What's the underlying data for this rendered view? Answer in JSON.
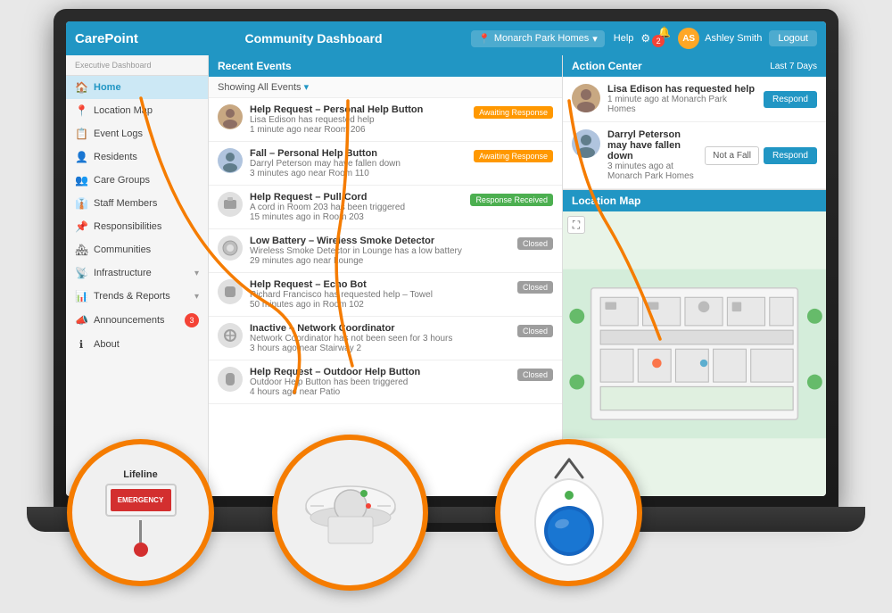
{
  "brand": "CarePoint",
  "topbar": {
    "title": "Community Dashboard",
    "location": "Monarch Park Homes",
    "help": "Help",
    "user": "Ashley Smith",
    "logout": "Logout",
    "notification_count": "2"
  },
  "sidebar": {
    "exec_label": "Executive Dashboard",
    "items": [
      {
        "id": "home",
        "label": "Home",
        "icon": "🏠",
        "active": true
      },
      {
        "id": "location-map",
        "label": "Location Map",
        "icon": "📍",
        "active": false
      },
      {
        "id": "event-logs",
        "label": "Event Logs",
        "icon": "📋",
        "active": false
      },
      {
        "id": "residents",
        "label": "Residents",
        "icon": "👤",
        "active": false
      },
      {
        "id": "care-groups",
        "label": "Care Groups",
        "icon": "👥",
        "active": false
      },
      {
        "id": "staff-members",
        "label": "Staff Members",
        "icon": "👔",
        "active": false
      },
      {
        "id": "responsibilities",
        "label": "Responsibilities",
        "icon": "📌",
        "active": false
      },
      {
        "id": "communities",
        "label": "Communities",
        "icon": "🏘",
        "active": false
      },
      {
        "id": "infrastructure",
        "label": "Infrastructure",
        "icon": "📡",
        "active": false,
        "has_arrow": true
      },
      {
        "id": "trends-reports",
        "label": "Trends & Reports",
        "icon": "📊",
        "active": false,
        "has_arrow": true
      },
      {
        "id": "announcements",
        "label": "Announcements",
        "icon": "📣",
        "active": false,
        "badge": "3"
      },
      {
        "id": "about",
        "label": "About",
        "icon": "ℹ",
        "active": false
      }
    ]
  },
  "recent_events": {
    "header": "Recent Events",
    "filter": "Showing All Events",
    "items": [
      {
        "id": 1,
        "title": "Help Request – Personal Help Button",
        "sub1": "Lisa Edison has requested help",
        "sub2": "1 minute ago near Room 206",
        "badge": "Awaiting Response",
        "badge_type": "awaiting",
        "icon_type": "person"
      },
      {
        "id": 2,
        "title": "Fall – Personal Help Button",
        "sub1": "Darryl Peterson may have fallen down",
        "sub2": "3 minutes ago near Room 110",
        "badge": "Awaiting Response",
        "badge_type": "awaiting",
        "icon_type": "person"
      },
      {
        "id": 3,
        "title": "Help Request – Pull Cord",
        "sub1": "A cord in Room 203 has been triggered",
        "sub2": "15 minutes ago in Room 203",
        "badge": "Response Received",
        "badge_type": "received",
        "icon_type": "pullcord"
      },
      {
        "id": 4,
        "title": "Low Battery – Wireless Smoke Detector",
        "sub1": "Wireless Smoke Detector in Lounge has a low battery",
        "sub2": "29 minutes ago near Lounge",
        "badge": "Closed",
        "badge_type": "closed",
        "icon_type": "smoke"
      },
      {
        "id": 5,
        "title": "Help Request – Echo Bot",
        "sub1": "Richard Francisco has requested help – Towel",
        "sub2": "50 minutes ago in Room 102",
        "badge": "Closed",
        "badge_type": "closed",
        "icon_type": "device"
      },
      {
        "id": 6,
        "title": "Inactive – Network Coordinator",
        "sub1": "Network Coordinator has not been seen for 3 hours",
        "sub2": "3 hours ago near Stairway 2",
        "badge": "Closed",
        "badge_type": "closed",
        "icon_type": "network"
      },
      {
        "id": 7,
        "title": "Help Request – Outdoor Help Button",
        "sub1": "Outdoor Help Button has been triggered",
        "sub2": "4 hours ago near Patio",
        "badge": "Closed",
        "badge_type": "closed",
        "icon_type": "outdoor"
      }
    ]
  },
  "action_center": {
    "header": "Action Center",
    "last_days": "Last 7 Days",
    "items": [
      {
        "id": 1,
        "name": "Lisa Edison has requested help",
        "sub": "1 minute ago at Monarch Park Homes",
        "action": "Respond",
        "icon_type": "person1"
      },
      {
        "id": 2,
        "name": "Darryl Peterson may have fallen down",
        "sub": "3 minutes ago at Monarch Park Homes",
        "action1": "Not a Fall",
        "action2": "Respond",
        "icon_type": "person2"
      }
    ]
  },
  "location_map": {
    "header": "Location Map"
  },
  "devices": [
    {
      "id": "pullcord",
      "label": "Lifeline",
      "emergency": "EMERGENCY"
    },
    {
      "id": "smoke",
      "label": ""
    },
    {
      "id": "helpbutton",
      "label": ""
    }
  ]
}
